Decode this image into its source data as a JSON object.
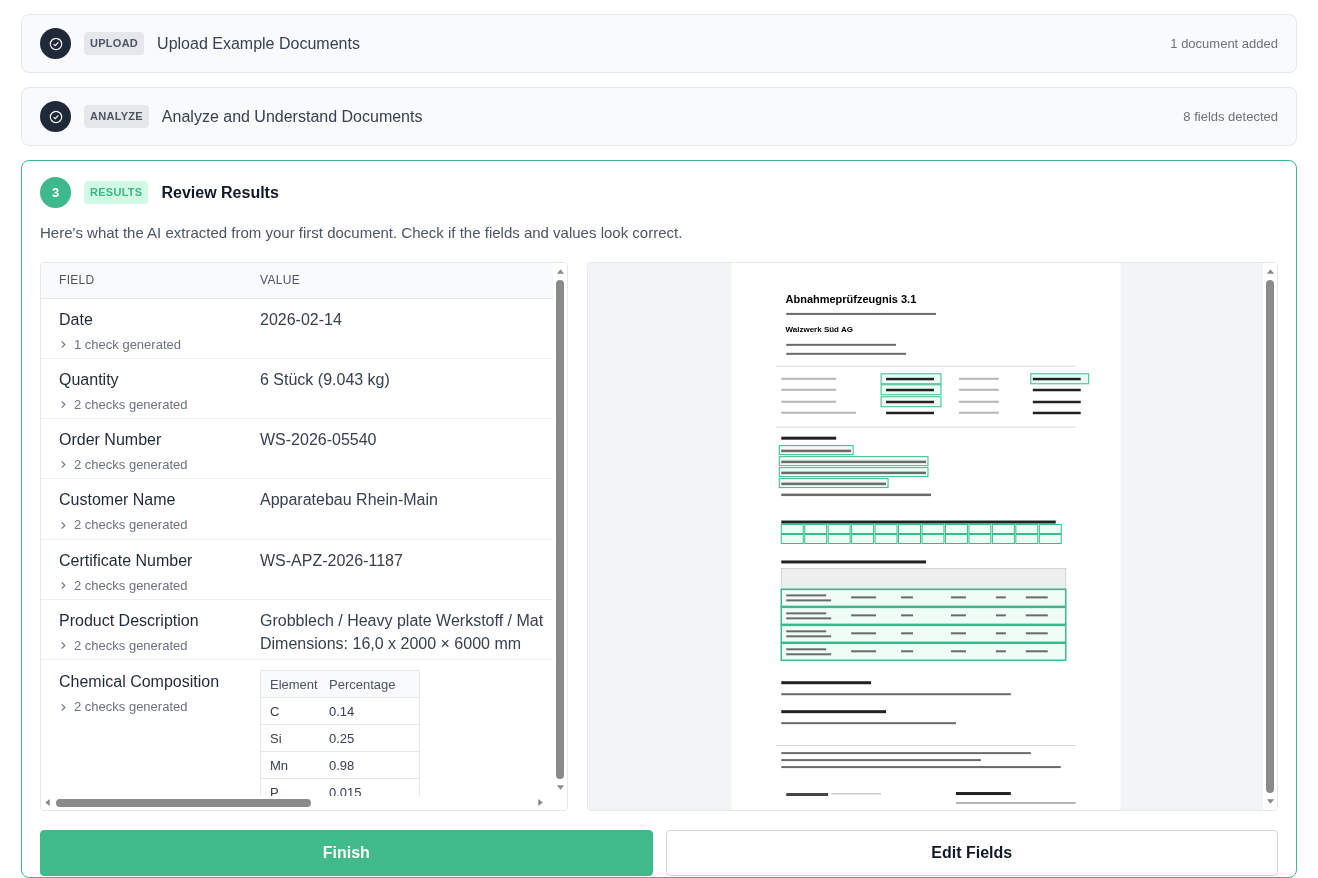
{
  "steps": [
    {
      "completed": true,
      "tag": "UPLOAD",
      "title": "Upload Example Documents",
      "summary": "1 document added"
    },
    {
      "completed": true,
      "tag": "ANALYZE",
      "title": "Analyze and Understand Documents",
      "summary": "8 fields detected"
    },
    {
      "completed": false,
      "number": "3",
      "tag": "RESULTS",
      "title": "Review Results",
      "description": "Here's what the AI extracted from your first document. Check if the fields and values look correct."
    }
  ],
  "results": {
    "columns": [
      "FIELD",
      "VALUE"
    ],
    "rows": [
      {
        "field": "Date",
        "checks": "1 check generated",
        "kind": "text",
        "value": [
          "2026-02-14"
        ]
      },
      {
        "field": "Quantity",
        "checks": "2 checks generated",
        "kind": "text",
        "value": [
          "6 Stück (9.043 kg)"
        ]
      },
      {
        "field": "Order Number",
        "checks": "2 checks generated",
        "kind": "text",
        "value": [
          "WS-2026-05540"
        ]
      },
      {
        "field": "Customer Name",
        "checks": "2 checks generated",
        "kind": "text",
        "value": [
          "Apparatebau Rhein-Main"
        ]
      },
      {
        "field": "Certificate Number",
        "checks": "2 checks generated",
        "kind": "text",
        "value": [
          "WS-APZ-2026-1187"
        ]
      },
      {
        "field": "Product Description",
        "checks": "2 checks generated",
        "kind": "text",
        "value": [
          "Grobblech / Heavy plate Werkstoff / Mat",
          "Dimensions: 16,0 x 2000 × 6000 mm"
        ]
      },
      {
        "field": "Chemical Composition",
        "checks": "2 checks generated",
        "kind": "table",
        "table": {
          "columns": [
            "Element",
            "Percentage"
          ],
          "rows": [
            [
              "C",
              "0.14"
            ],
            [
              "Si",
              "0.25"
            ],
            [
              "Mn",
              "0.98"
            ],
            [
              "P",
              "0.015"
            ]
          ]
        }
      }
    ]
  },
  "document": {
    "title": "Abnahmeprüfzeugnis 3.1",
    "company": "Walzwerk Süd AG"
  },
  "buttons": [
    {
      "kind": "primary",
      "label": "Finish"
    },
    {
      "kind": "secondary",
      "label": "Edit Fields"
    }
  ]
}
